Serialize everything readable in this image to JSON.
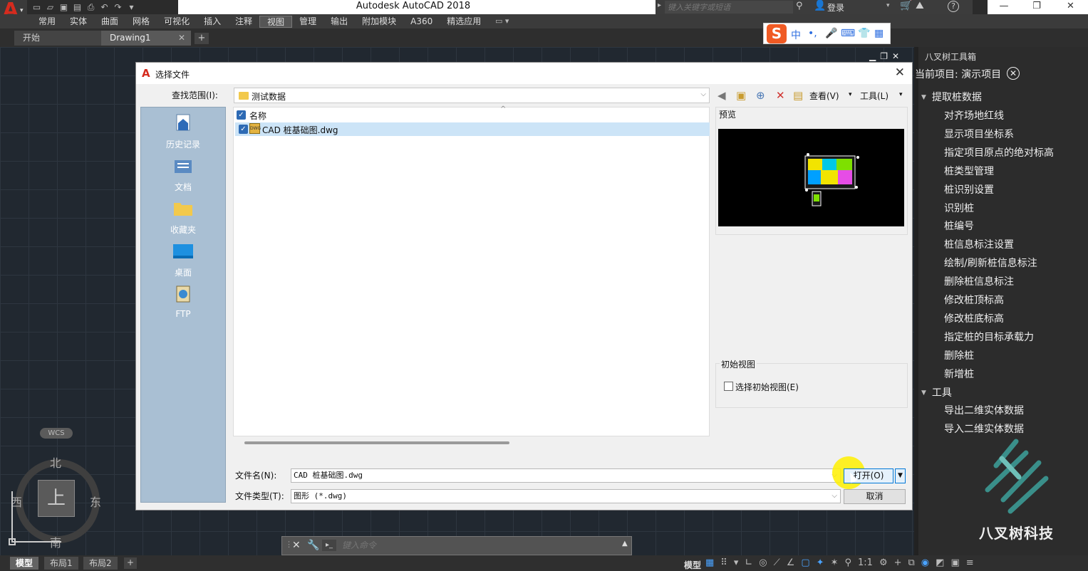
{
  "app": {
    "title": "Autodesk AutoCAD 2018",
    "search_placeholder": "键入关键字或短语",
    "login": "登录",
    "help": "?"
  },
  "ribbon": {
    "tabs": [
      "常用",
      "实体",
      "曲面",
      "网格",
      "可视化",
      "插入",
      "注释",
      "视图",
      "管理",
      "输出",
      "附加模块",
      "A360",
      "精选应用"
    ],
    "active_tab": "视图"
  },
  "file_tabs": {
    "start": "开始",
    "drawing": "Drawing1",
    "add": "+"
  },
  "ime": {
    "logo": "S",
    "items": [
      "中",
      "•,",
      "🎤",
      "⌨",
      "👕",
      "▦"
    ]
  },
  "viewcube": {
    "wcs": "WCS",
    "north": "北",
    "south": "南",
    "east": "东",
    "west": "西",
    "face": "上"
  },
  "command": {
    "placeholder": "键入命令"
  },
  "statusbar": {
    "layout_tabs": [
      "模型",
      "布局1",
      "布局2"
    ],
    "active_layout": "模型",
    "add": "+",
    "model_label": "模型",
    "scale": "1:1"
  },
  "palette": {
    "title": "八叉树工具箱",
    "current_project_label": "当前项目: 演示项目",
    "groups": [
      {
        "label": "提取桩数据",
        "items": [
          "对齐场地红线",
          "显示项目坐标系",
          "指定项目原点的绝对标高",
          "桩类型管理",
          "桩识别设置",
          "识别桩",
          "桩编号",
          "桩信息标注设置",
          "绘制/刷新桩信息标注",
          "删除桩信息标注",
          "修改桩顶标高",
          "修改桩底标高",
          "指定桩的目标承载力",
          "删除桩",
          "新增桩"
        ]
      },
      {
        "label": "工具",
        "items": [
          "导出二维实体数据",
          "导入二维实体数据"
        ]
      }
    ],
    "brand_name": "八叉树科技"
  },
  "dialog": {
    "title": "选择文件",
    "look_in_label": "查找范围(I):",
    "look_in_value": "测试数据",
    "toolbar": {
      "view_label": "查看(V)",
      "tools_label": "工具(L)"
    },
    "places": [
      {
        "label": "历史记录",
        "icon": "history-icon"
      },
      {
        "label": "文档",
        "icon": "documents-icon"
      },
      {
        "label": "收藏夹",
        "icon": "favorites-folder-icon"
      },
      {
        "label": "桌面",
        "icon": "desktop-icon"
      },
      {
        "label": "FTP",
        "icon": "ftp-icon"
      }
    ],
    "column_name": "名称",
    "files": [
      {
        "name": "CAD 桩基础图.dwg",
        "selected": true
      }
    ],
    "preview_label": "预览",
    "initial_view_group": "初始视图",
    "initial_view_checkbox": "选择初始视图(E)",
    "file_name_label": "文件名(N):",
    "file_name_value": "CAD 桩基础图.dwg",
    "file_type_label": "文件类型(T):",
    "file_type_value": "图形 (*.dwg)",
    "open_button": "打开(O)",
    "cancel_button": "取消"
  }
}
